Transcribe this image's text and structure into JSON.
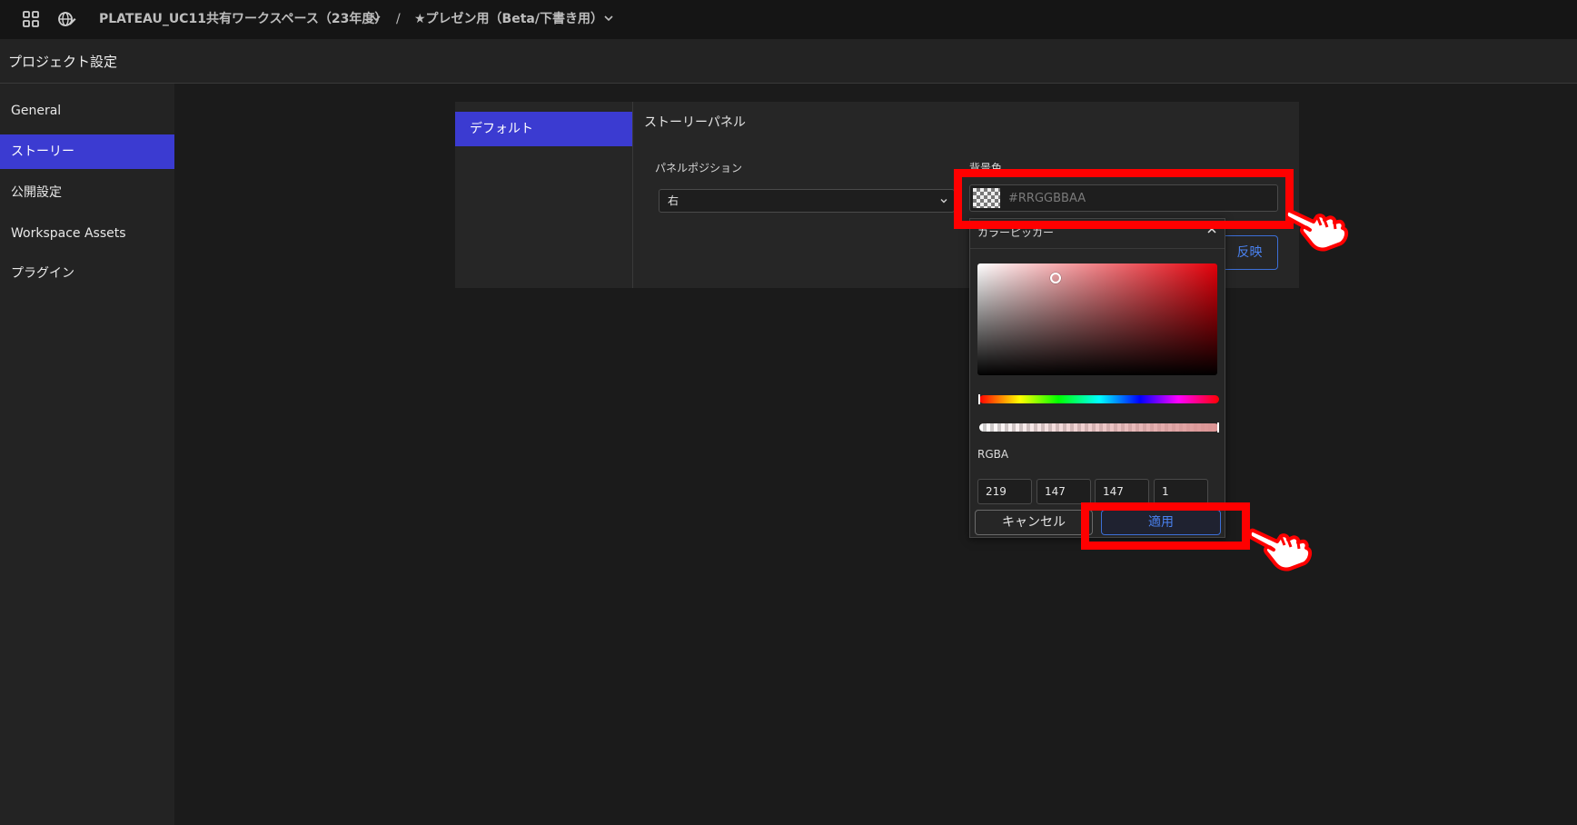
{
  "topbar": {
    "workspace": "PLATEAU_UC11共有ワークスペース（23年度）",
    "separator": "/",
    "project": "★プレゼン用（Beta/下書き用）"
  },
  "header": {
    "title": "プロジェクト設定"
  },
  "sidebar": {
    "items": [
      {
        "label": "General"
      },
      {
        "label": "ストーリー"
      },
      {
        "label": "公開設定"
      },
      {
        "label": "Workspace Assets"
      },
      {
        "label": "プラグイン"
      }
    ],
    "active_index": 1
  },
  "story": {
    "tab_default": "デフォルト",
    "section_title": "ストーリーパネル",
    "panel_position_label": "パネルポジション",
    "panel_position_value": "右",
    "bg_color_label": "背景色",
    "bg_color_placeholder": "#RRGGBBAA",
    "apply_label": "反映"
  },
  "color_picker": {
    "title": "カラーピッカー",
    "rgba_label": "RGBA",
    "r": "219",
    "g": "147",
    "b": "147",
    "a": "1",
    "hue": 0,
    "alpha": 1,
    "cancel_label": "キャンセル",
    "apply_label": "適用"
  },
  "colors": {
    "accent": "#3b3bd1",
    "link_blue": "#4a82f0",
    "annotation_red": "#ff0000"
  }
}
